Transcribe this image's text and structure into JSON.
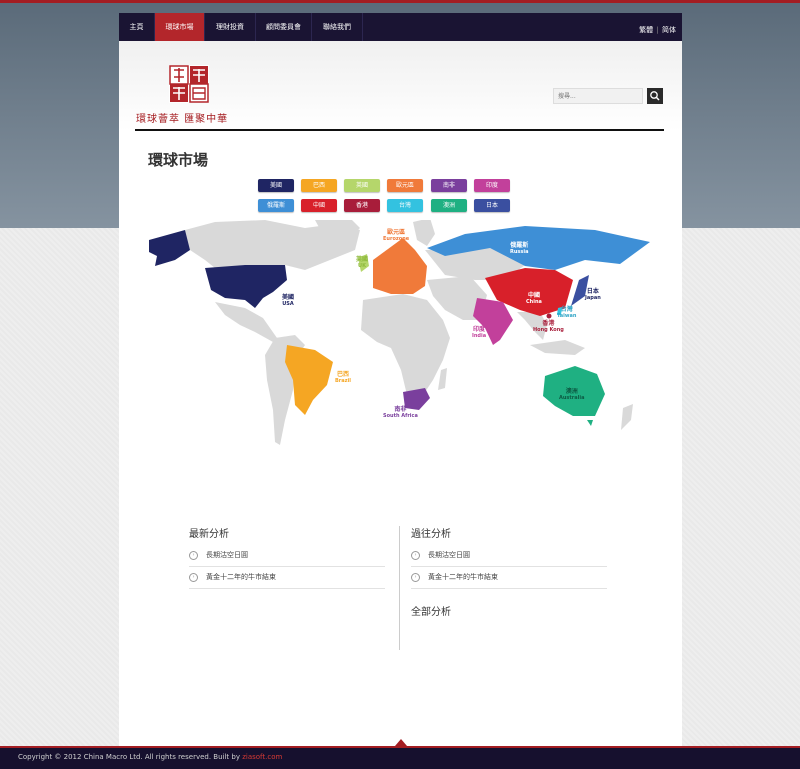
{
  "nav": {
    "items": [
      {
        "label": "主頁"
      },
      {
        "label": "環球市場"
      },
      {
        "label": "理財投資"
      },
      {
        "label": "顧問委員會"
      },
      {
        "label": "聯絡我們"
      }
    ],
    "lang": {
      "trad": "繁體",
      "sep": "|",
      "simp": "简体"
    }
  },
  "header": {
    "logo_text": "中華智庫",
    "slogan": "環球薈萃 匯聚中華"
  },
  "search": {
    "placeholder": "搜尋..."
  },
  "page_title": "環球市場",
  "legend": [
    {
      "label": "美國",
      "color": "#1f2563"
    },
    {
      "label": "巴西",
      "color": "#f5a623"
    },
    {
      "label": "英國",
      "color": "#b5d66b"
    },
    {
      "label": "歐元區",
      "color": "#f07a3a"
    },
    {
      "label": "南非",
      "color": "#7a3f9d"
    },
    {
      "label": "印度",
      "color": "#c2409b"
    },
    {
      "label": "俄羅斯",
      "color": "#3e8fd6"
    },
    {
      "label": "中國",
      "color": "#d8202a"
    },
    {
      "label": "香港",
      "color": "#a81d3a"
    },
    {
      "label": "台灣",
      "color": "#33c2e0"
    },
    {
      "label": "澳洲",
      "color": "#1fb082"
    },
    {
      "label": "日本",
      "color": "#3a4fa0"
    }
  ],
  "map_labels": {
    "usa": {
      "zh": "美國",
      "en": "USA",
      "color": "#1f2563"
    },
    "brazil": {
      "zh": "巴西",
      "en": "Brazil",
      "color": "#f5a623"
    },
    "uk": {
      "zh": "英國",
      "en": "UK",
      "color": "#8fba3e"
    },
    "eurozone": {
      "zh": "歐元區",
      "en": "Eurozone",
      "color": "#f07a3a"
    },
    "south_africa": {
      "zh": "南非",
      "en": "South Africa",
      "color": "#7a3f9d"
    },
    "india": {
      "zh": "印度",
      "en": "India",
      "color": "#c2409b"
    },
    "russia": {
      "zh": "俄羅斯",
      "en": "Russia",
      "color": "#ffffff"
    },
    "china": {
      "zh": "中國",
      "en": "China",
      "color": "#ffffff"
    },
    "hongkong": {
      "zh": "香港",
      "en": "Hong Kong",
      "color": "#a81d3a"
    },
    "taiwan": {
      "zh": "台灣",
      "en": "Taiwan",
      "color": "#33a6c7"
    },
    "australia": {
      "zh": "澳洲",
      "en": "Australia",
      "color": "#0d5b44"
    },
    "japan": {
      "zh": "日本",
      "en": "Japan",
      "color": "#1f2563"
    }
  },
  "latest": {
    "title": "最新分析",
    "items": [
      "長期沽空日圓",
      "黃金十二年的牛市結束"
    ]
  },
  "past": {
    "title": "過往分析",
    "items": [
      "長期沽空日圓",
      "黃金十二年的牛市結束"
    ],
    "all_label": "全部分析"
  },
  "footer": {
    "text": "Copyright © 2012 China Macro Ltd. All rights reserved. Built by ",
    "link": "ziasoft.com"
  }
}
